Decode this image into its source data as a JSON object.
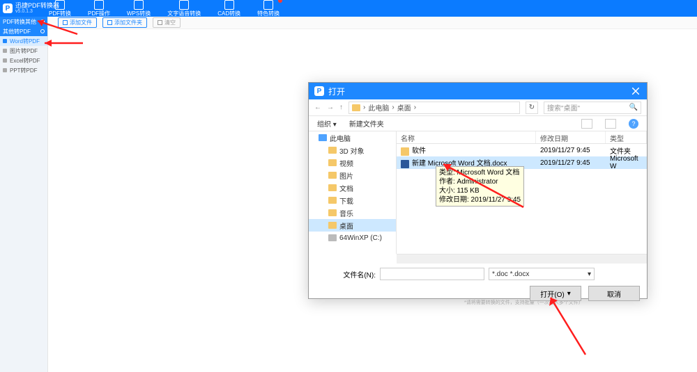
{
  "app": {
    "logo": "P",
    "title": "迅捷PDF转换器",
    "version": "v5.0.1.3"
  },
  "maintabs": [
    {
      "label": "PDF转换"
    },
    {
      "label": "PDF操作"
    },
    {
      "label": "WPS转换"
    },
    {
      "label": "文字语音转换"
    },
    {
      "label": "CAD转换"
    },
    {
      "label": "特色转换",
      "badge": true
    }
  ],
  "sidebar": {
    "section1": "PDF转换其他",
    "section2": "其他转PDF",
    "items": [
      {
        "label": "Word转PDF",
        "active": true
      },
      {
        "label": "图片转PDF"
      },
      {
        "label": "Excel转PDF"
      },
      {
        "label": "PPT转PDF"
      }
    ]
  },
  "toolbar": {
    "add_file": "添加文件",
    "add_folder": "添加文件夹",
    "clear": "清空"
  },
  "dialog": {
    "title": "打开",
    "nav_back": "←",
    "nav_fwd": "→",
    "nav_up": "↑",
    "crumbs": [
      "此电脑",
      "桌面"
    ],
    "crumb_sep": "›",
    "refresh": "↻",
    "search_placeholder": "搜索\"桌面\"",
    "organize": "组织 ▾",
    "new_folder": "新建文件夹",
    "help": "?",
    "tree": [
      {
        "label": "此电脑",
        "type": "pc"
      },
      {
        "label": "3D 对象",
        "type": "folder",
        "indent": true
      },
      {
        "label": "视频",
        "type": "folder",
        "indent": true
      },
      {
        "label": "图片",
        "type": "folder",
        "indent": true
      },
      {
        "label": "文档",
        "type": "folder",
        "indent": true
      },
      {
        "label": "下载",
        "type": "folder",
        "indent": true
      },
      {
        "label": "音乐",
        "type": "folder",
        "indent": true
      },
      {
        "label": "桌面",
        "type": "folder",
        "indent": true,
        "selected": true
      },
      {
        "label": "64WinXP  (C:)",
        "type": "drive",
        "indent": true
      }
    ],
    "columns": {
      "name": "名称",
      "date": "修改日期",
      "type": "类型"
    },
    "rows": [
      {
        "name": "软件",
        "date": "2019/11/27 9:45",
        "type": "文件夹",
        "icon": "folder"
      },
      {
        "name": "新建 Microsoft Word 文档.docx",
        "date": "2019/11/27 9:45",
        "type": "Microsoft W",
        "icon": "word",
        "selected": true
      }
    ],
    "tooltip": {
      "l1": "类型: Microsoft Word 文档",
      "l2": "作者: Administrator",
      "l3": "大小: 115 KB",
      "l4": "修改日期: 2019/11/27 9:45"
    },
    "filename_label": "文件名(N):",
    "filter": "*.doc *.docx",
    "open_btn": "打开(O)",
    "cancel_btn": "取消"
  },
  "footer_hint": "*请将需要转换的文件，支持批量（一次拖入多个文件）"
}
